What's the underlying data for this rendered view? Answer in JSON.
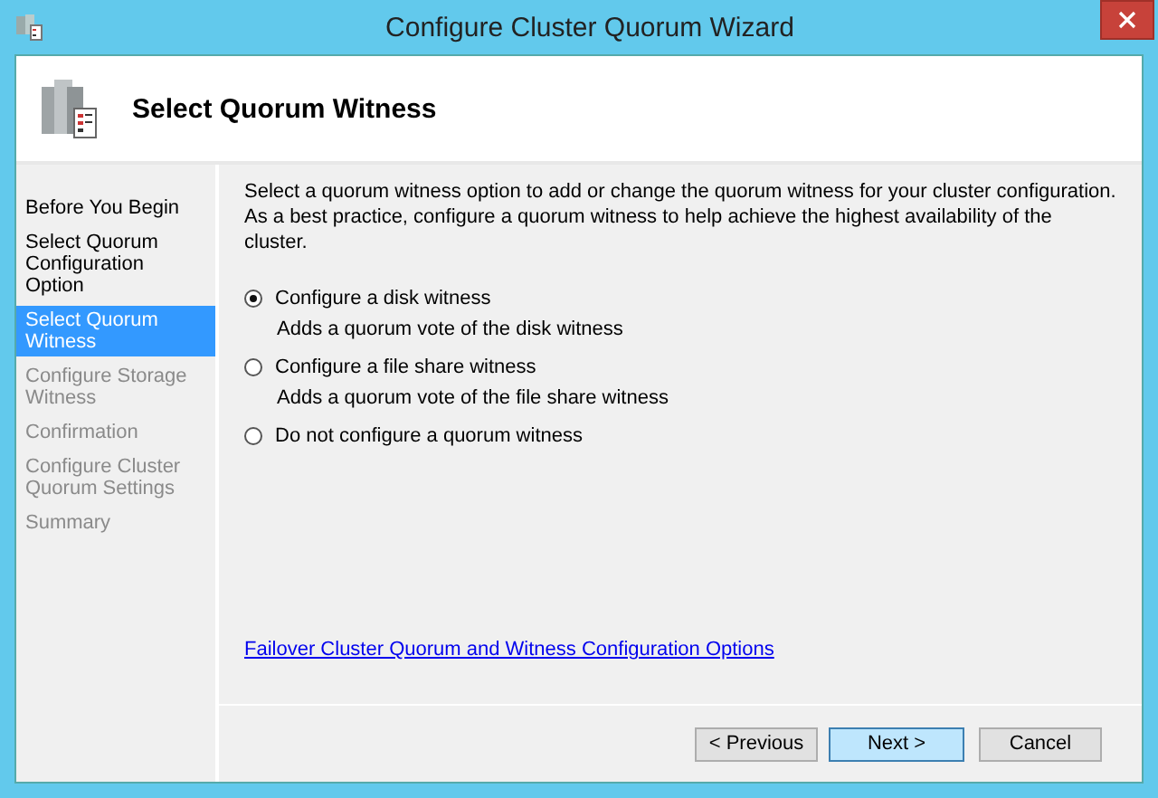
{
  "window": {
    "title": "Configure Cluster Quorum Wizard"
  },
  "header": {
    "title": "Select Quorum Witness"
  },
  "steps": [
    {
      "label": "Before You Begin",
      "selected": false,
      "disabled": false
    },
    {
      "label": "Select Quorum Configuration Option",
      "selected": false,
      "disabled": false
    },
    {
      "label": "Select Quorum Witness",
      "selected": true,
      "disabled": false
    },
    {
      "label": "Configure Storage Witness",
      "selected": false,
      "disabled": true
    },
    {
      "label": "Confirmation",
      "selected": false,
      "disabled": true
    },
    {
      "label": "Configure Cluster Quorum Settings",
      "selected": false,
      "disabled": true
    },
    {
      "label": "Summary",
      "selected": false,
      "disabled": true
    }
  ],
  "description": "Select a quorum witness option to add or change the quorum witness for your cluster configuration. As a best practice, configure a quorum witness to help achieve the highest availability of the cluster.",
  "options": [
    {
      "label": "Configure a disk witness",
      "detail": "Adds a quorum vote of the disk witness",
      "selected": true
    },
    {
      "label": "Configure a file share witness",
      "detail": "Adds a quorum vote of the file share witness",
      "selected": false
    },
    {
      "label": "Do not configure a quorum witness",
      "selected": false
    }
  ],
  "link": "Failover Cluster Quorum and Witness Configuration Options",
  "buttons": [
    {
      "label": "< Previous",
      "kind": "normal"
    },
    {
      "label": "Next >",
      "kind": "default"
    },
    {
      "label": "Cancel",
      "kind": "normal"
    }
  ]
}
